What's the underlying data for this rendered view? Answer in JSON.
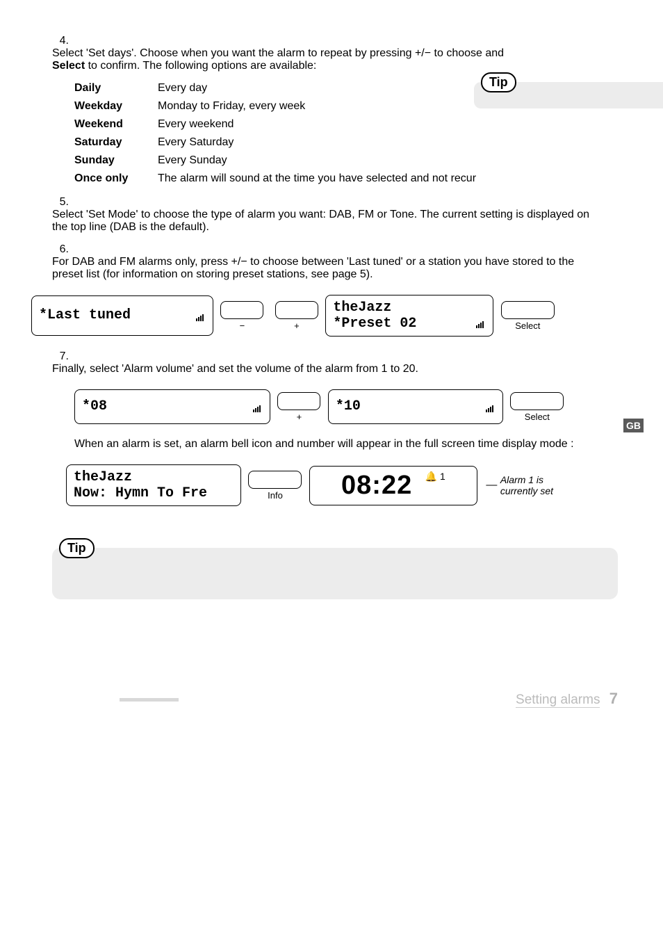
{
  "steps": {
    "s4num": "4.",
    "s4a": "Select 'Set days'. Choose when you want the alarm to repeat by pressing +/−  to choose and",
    "s4b": "Select",
    "s4c": " to confirm. The following options are available:",
    "opts": [
      {
        "k": "Daily",
        "v": "Every day"
      },
      {
        "k": "Weekday",
        "v": "Monday to Friday, every week"
      },
      {
        "k": "Weekend",
        "v": "Every weekend"
      },
      {
        "k": "Saturday",
        "v": "Every Saturday"
      },
      {
        "k": "Sunday",
        "v": "Every Sunday"
      },
      {
        "k": "Once only",
        "v": "The alarm will sound at the time you have selected and not recur"
      }
    ],
    "tip1": "Tip",
    "s5num": "5.",
    "s5": "Select 'Set Mode' to choose the type of alarm you want: DAB, FM or Tone. The current setting is displayed on the top line (DAB is the default).",
    "s6num": "6.",
    "s6": "For DAB and FM alarms only, press +/− to choose between 'Last tuned' or a station you have stored to the preset list (for information on storing preset stations, see page 5).",
    "d1": "*Last tuned",
    "d2a": "theJazz",
    "d2b": "*Preset 02",
    "minus": "−",
    "plus": "+",
    "select": "Select",
    "s7num": "7.",
    "s7": "Finally, select 'Alarm volume' and set the volume of the alarm from 1 to 20.",
    "v1": "*08",
    "v2": "*10",
    "after": "When an alarm is set, an alarm bell icon and number will appear in the full screen time display mode :",
    "np1": "theJazz",
    "np2": "Now: Hymn To Fre",
    "info": "Info",
    "clock": "08:22",
    "bellnum": " 1",
    "note1": "Alarm 1 is",
    "note2": "currently set",
    "tip2": "Tip",
    "gb": "GB",
    "footer_text": "Setting alarms",
    "page_num": "7"
  }
}
